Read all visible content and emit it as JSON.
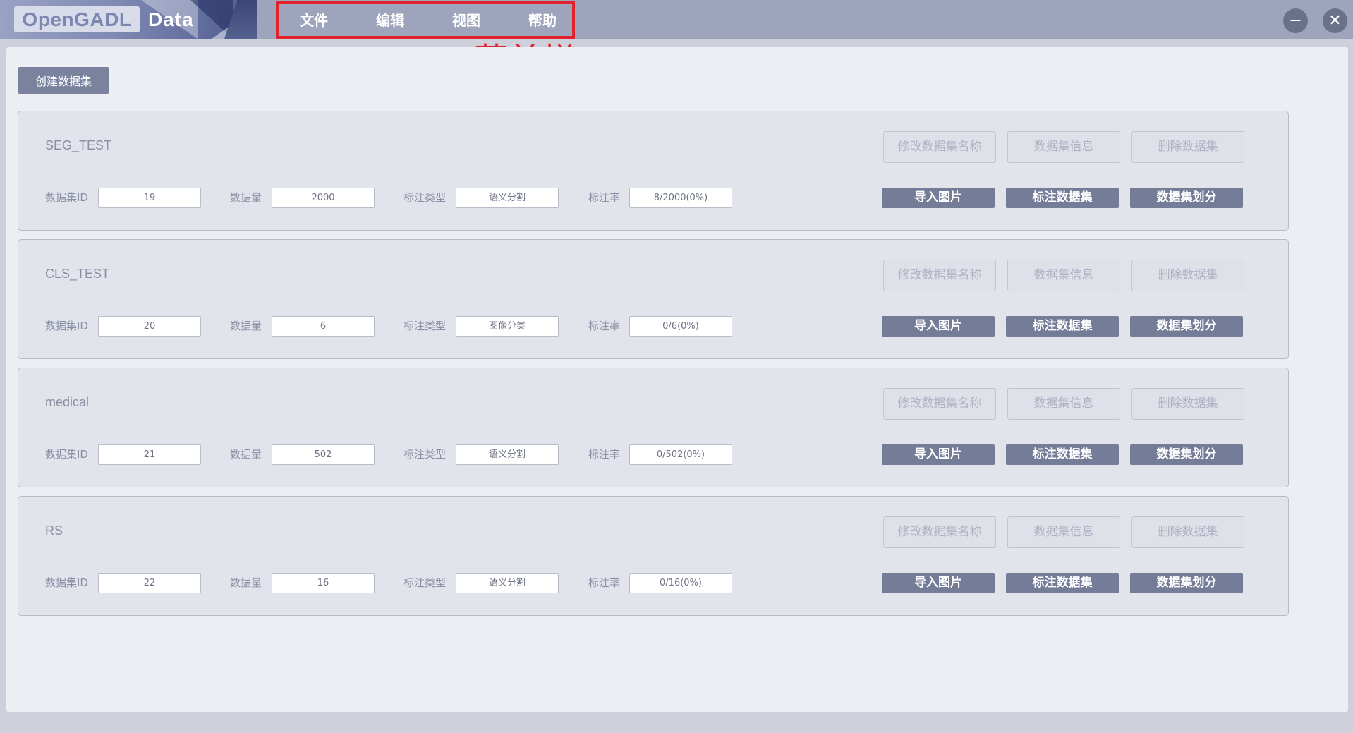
{
  "app": {
    "logo_left": "OpenGADL",
    "logo_right": "Data"
  },
  "menubar": {
    "items": [
      {
        "label": "文件"
      },
      {
        "label": "编辑"
      },
      {
        "label": "视图"
      },
      {
        "label": "帮助"
      }
    ],
    "annotation": "菜单栏"
  },
  "window_controls": {
    "minimize": "−",
    "close": "✕"
  },
  "toolbar": {
    "create_dataset_label": "创建数据集"
  },
  "labels": {
    "id": "数据集ID",
    "count": "数据量",
    "annotation_type": "标注类型",
    "annotation_rate": "标注率",
    "rename": "修改数据集名称",
    "info": "数据集信息",
    "delete": "删除数据集",
    "import": "导入图片",
    "annotate": "标注数据集",
    "split": "数据集划分"
  },
  "datasets": [
    {
      "name": "SEG_TEST",
      "id": "19",
      "count": "2000",
      "type": "语义分割",
      "rate": "8/2000(0%)"
    },
    {
      "name": "CLS_TEST",
      "id": "20",
      "count": "6",
      "type": "图像分类",
      "rate": "0/6(0%)"
    },
    {
      "name": "medical",
      "id": "21",
      "count": "502",
      "type": "语义分割",
      "rate": "0/502(0%)"
    },
    {
      "name": "RS",
      "id": "22",
      "count": "16",
      "type": "语义分割",
      "rate": "0/16(0%)"
    }
  ],
  "colors": {
    "topbar": "#9ea4bb",
    "accent": "#747c98",
    "highlight_box": "#e0232a"
  }
}
